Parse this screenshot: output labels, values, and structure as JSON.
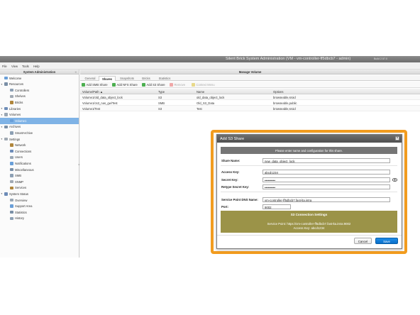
{
  "window": {
    "title": "Silent Brick System Administration (VM - vm-controller-ff5dbcb7 - admin)",
    "build": "Build 2.57.0"
  },
  "menubar": [
    "File",
    "View",
    "Tools",
    "Help"
  ],
  "left_pane": {
    "title": "System Administration",
    "items": [
      {
        "label": "Welcome",
        "icon": "welcome-icon",
        "level": 0
      },
      {
        "label": "Resources",
        "icon": "resources-icon",
        "level": 0
      },
      {
        "label": "Controllers",
        "icon": "controllers-icon",
        "level": 1
      },
      {
        "label": "Shelves",
        "icon": "shelves-icon",
        "level": 1
      },
      {
        "label": "Bricks",
        "icon": "bricks-icon",
        "level": 1
      },
      {
        "label": "Libraries",
        "icon": "libraries-icon",
        "level": 0
      },
      {
        "label": "Volumes",
        "icon": "volumes-icon",
        "level": 0
      },
      {
        "label": "Volume1",
        "icon": "volume-icon",
        "level": 1,
        "selected": true
      },
      {
        "label": "Archives",
        "icon": "archives-icon",
        "level": 0
      },
      {
        "label": "SmartArchive",
        "icon": "archive-icon",
        "level": 1
      },
      {
        "label": "Settings",
        "icon": "settings-icon",
        "level": 0
      },
      {
        "label": "Network",
        "icon": "network-icon",
        "level": 1
      },
      {
        "label": "Connections",
        "icon": "connections-icon",
        "level": 1
      },
      {
        "label": "Users",
        "icon": "users-icon",
        "level": 1
      },
      {
        "label": "Notifications",
        "icon": "notifications-icon",
        "level": 1
      },
      {
        "label": "Miscellaneous",
        "icon": "misc-icon",
        "level": 1
      },
      {
        "label": "SMB",
        "icon": "smb-icon",
        "level": 1
      },
      {
        "label": "SNMP",
        "icon": "snmp-icon",
        "level": 1
      },
      {
        "label": "Services",
        "icon": "services-icon",
        "level": 1
      },
      {
        "label": "System Status",
        "icon": "status-icon",
        "level": 0
      },
      {
        "label": "Overview",
        "icon": "overview-icon",
        "level": 1
      },
      {
        "label": "Support Area",
        "icon": "support-icon",
        "level": 1
      },
      {
        "label": "Statistics",
        "icon": "statistics-icon",
        "level": 1
      },
      {
        "label": "History",
        "icon": "history-icon",
        "level": 1
      }
    ]
  },
  "right_pane": {
    "title": "Manage Volume",
    "tabs": [
      "General",
      "Shares",
      "Snapshots",
      "Bricks",
      "Statistics"
    ],
    "active_tab": "Shares",
    "toolbar": {
      "add_smb": "Add SMB Share",
      "add_nfs": "Add NFS Share",
      "add_s3": "Add S3 Share",
      "remove": "Remove",
      "context_menu": "Context Menu"
    },
    "table": {
      "headers": [
        "Volume/Path",
        "Type",
        "Name",
        "Options"
      ],
      "rows": [
        [
          "Volume1/old_data_object_lock",
          "S3",
          "old_data_object_lock",
          "browseable,sroid"
        ],
        [
          "Volume1/cs3_nas_gw/Test",
          "SMB",
          "Old_S3_Data",
          "browseable,public"
        ],
        [
          "Volume1/Test",
          "S3",
          "Test",
          "browseable,sroid"
        ]
      ]
    }
  },
  "dialog": {
    "title": "Add S3 Share",
    "banner": "Please enter name and configuration for this share.",
    "fields": {
      "share_name_label": "Share Name:",
      "share_name_value": "new_data_object_lock",
      "access_key_label": "Access Key:",
      "access_key_value": "abcd1234",
      "secret_key_label": "Secret Key:",
      "secret_key_value": "••••••••••",
      "retype_secret_label": "Retype Secret Key:",
      "retype_secret_value": "••••••••••",
      "dns_name_label": "Service Point DNS Name:",
      "dns_name_value": "vm-controller-ff5dbcb7.fast-lta.intra",
      "port_label": "Port:",
      "port_value": "9002"
    },
    "connection": {
      "heading": "S3 Connection Settings",
      "service_point": "Service Point: https://vm-controller-ff5dbcb7.fast-lta.intra:9002",
      "access_key": "Access Key: abcd1234"
    },
    "cancel": "Cancel",
    "save": "Save",
    "highlight_color": "#f29c1f",
    "save_color": "#0a6fc9",
    "info_color": "#9b9348"
  }
}
